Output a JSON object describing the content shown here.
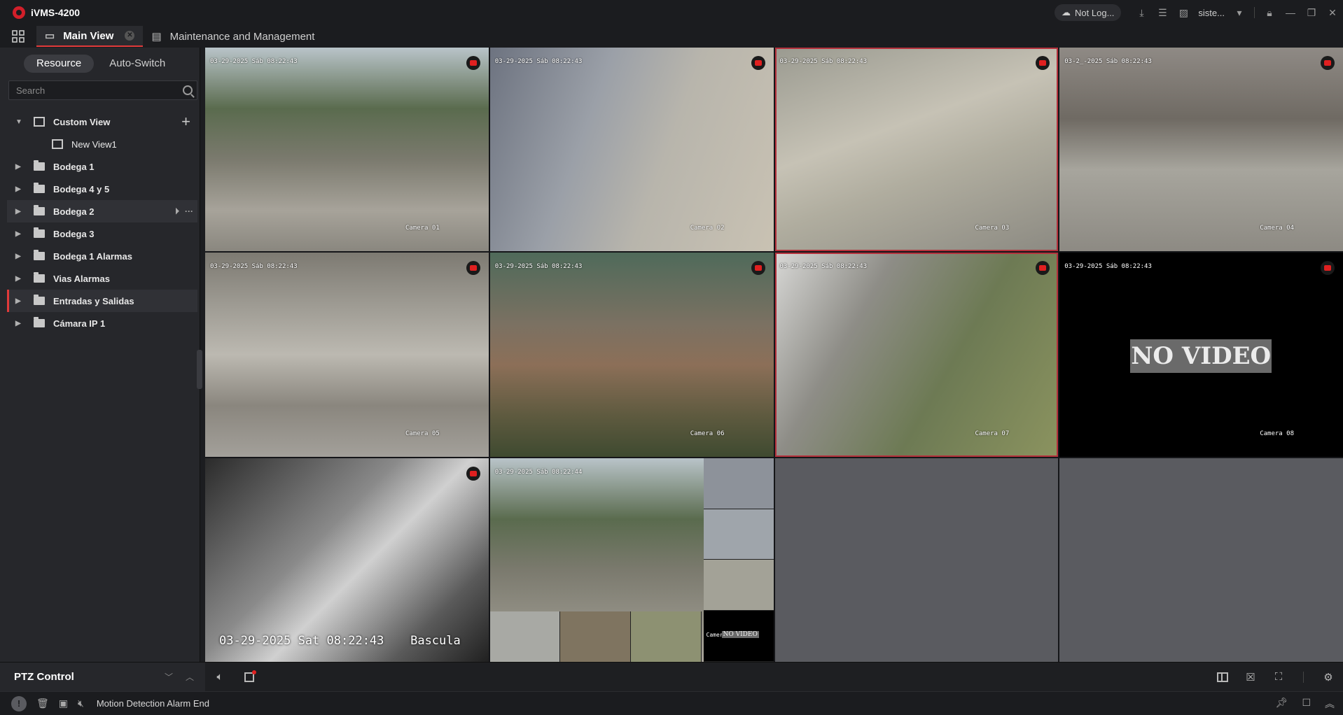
{
  "app": {
    "title": "iVMS-4200",
    "login_status": "Not Log...",
    "user": "siste..."
  },
  "tabs": [
    {
      "label": "Main View",
      "active": true
    },
    {
      "label": "Maintenance and Management",
      "active": false
    }
  ],
  "sidebar": {
    "segments": [
      {
        "label": "Resource"
      },
      {
        "label": "Auto-Switch"
      }
    ],
    "search_placeholder": "Search",
    "tree": [
      {
        "label": "Custom View"
      },
      {
        "label": "New View1"
      },
      {
        "label": "Bodega 1"
      },
      {
        "label": "Bodega 4 y 5"
      },
      {
        "label": "Bodega 2"
      },
      {
        "label": "Bodega 3"
      },
      {
        "label": "Bodega 1 Alarmas"
      },
      {
        "label": "Vias Alarmas"
      },
      {
        "label": "Entradas y Salidas"
      },
      {
        "label": "Cámara IP 1"
      }
    ]
  },
  "cameras": [
    {
      "time": "03-29-2025 Sáb 08:22:43",
      "name": "Camera 01"
    },
    {
      "time": "03-29-2025 Sáb 08:22:43",
      "name": "Camera 02"
    },
    {
      "time": "03-29-2025 Sáb 08:22:43",
      "name": "Camera 03"
    },
    {
      "time": "03-2_-2025 Sáb 08:22:43",
      "name": "Camera 04"
    },
    {
      "time": "03-29-2025 Sáb 08:22:43",
      "name": "Camera 05"
    },
    {
      "time": "03-29-2025 Sáb 08:22:43",
      "name": "Camera 06"
    },
    {
      "time": "03-29-2025 Sáb 08:22:43",
      "name": "Camera 07"
    },
    {
      "time": "03-29-2025 Sáb 08:22:43",
      "name": "Camera 08",
      "no_video": "NO VIDEO"
    },
    {
      "time": "03-29-2025 Sat 08:22:43",
      "name": "Bascula"
    },
    {
      "time": "03-29-2025 Sáb 08:22:44",
      "name": "Camera 08",
      "no_video": "NO VIDEO"
    }
  ],
  "ptz": {
    "label": "PTZ Control"
  },
  "status": {
    "message": "Motion Detection Alarm End"
  },
  "colors": {
    "accent": "#e03a3a",
    "background": "#1c1d20",
    "panel": "#26272b"
  }
}
